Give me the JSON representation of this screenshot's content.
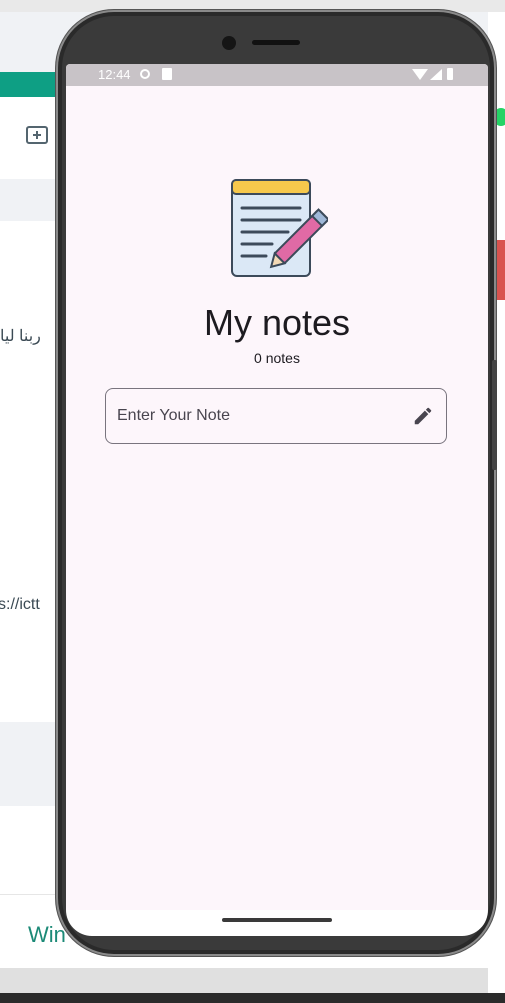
{
  "background_window": {
    "sidebar_snippets": [
      "ربنا ليا",
      "s://ictt"
    ],
    "bottom_label": "Win"
  },
  "phone": {
    "status_bar": {
      "time": "12:44"
    },
    "app": {
      "icon": "notepad-pencil-icon",
      "title": "My notes",
      "notes_count": "0 notes",
      "note_input": {
        "placeholder": "Enter Your Note",
        "value": "",
        "trailing_icon": "edit-icon"
      }
    }
  },
  "colors": {
    "screen_background": "#fdf6fb",
    "outline": "#79747e",
    "text": "#1d1b20",
    "pencil_pink": "#e06aa5",
    "notepad_header": "#f6c84c"
  }
}
